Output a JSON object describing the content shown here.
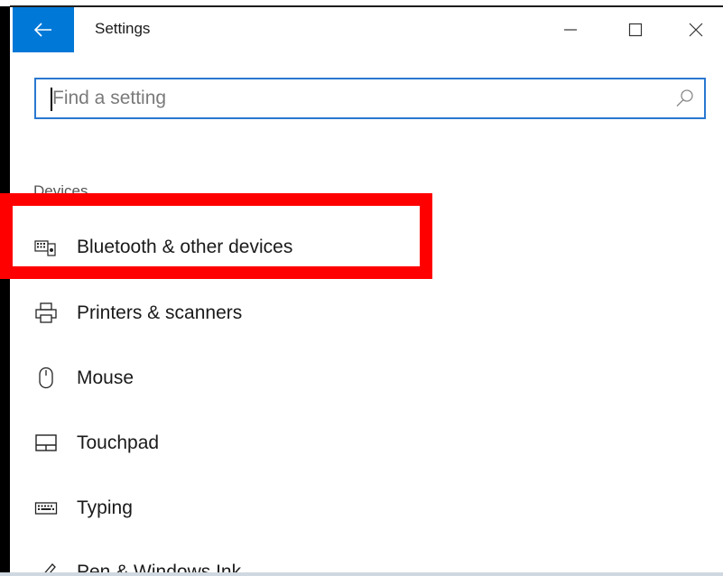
{
  "window": {
    "title": "Settings",
    "back_icon": "back-arrow-icon",
    "controls": [
      "minimize-icon",
      "maximize-icon",
      "close-icon"
    ]
  },
  "search": {
    "placeholder": "Find a setting",
    "value": "",
    "icon": "search-icon"
  },
  "group": {
    "label": "Devices"
  },
  "nav": {
    "items": [
      {
        "label": "Bluetooth & other devices",
        "icon": "bluetooth-devices-icon"
      },
      {
        "label": "Printers & scanners",
        "icon": "printer-icon"
      },
      {
        "label": "Mouse",
        "icon": "mouse-icon"
      },
      {
        "label": "Touchpad",
        "icon": "touchpad-icon"
      },
      {
        "label": "Typing",
        "icon": "keyboard-icon"
      },
      {
        "label": "Pen & Windows Ink",
        "icon": "pen-icon"
      }
    ]
  },
  "annotation": {
    "highlight_color": "#ff0000",
    "highlighted_item": "Bluetooth & other devices"
  },
  "colors": {
    "accent": "#0078d7",
    "search_border": "#2a78d0"
  }
}
